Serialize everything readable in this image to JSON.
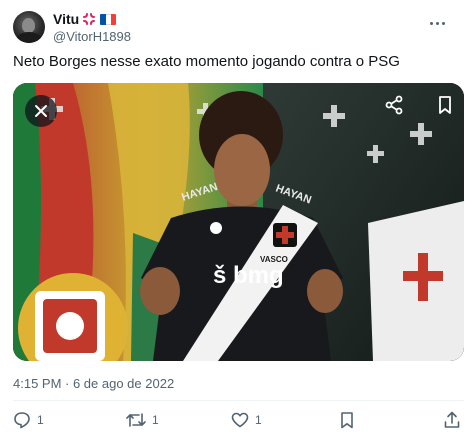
{
  "user": {
    "display_name": "Vitu",
    "handle": "@VitorH1898",
    "name_emoji": "anger-symbol-icon",
    "flag": "france-flag-icon",
    "flag_colors": [
      "#0055a4",
      "#ffffff",
      "#ef4135"
    ]
  },
  "tweet": {
    "text": "Neto Borges nesse exato momento jogando contra o PSG",
    "timestamp": "4:15 PM · 6 de ago de 2022"
  },
  "media": {
    "image": "photo-player-vasco-shirt",
    "shirt_texts": {
      "sponsor": "bmg",
      "sponsor_prefix": "š",
      "club": "VASCO",
      "shoulder_left": "HAYAN",
      "shoulder_right": "HAYAN"
    },
    "close_icon": "close-icon",
    "share_icon": "share-icon",
    "bookmark_icon": "bookmark-icon"
  },
  "actions": {
    "reply_count": "1",
    "retweet_count": "1",
    "like_count": "1",
    "icons": [
      "reply-icon",
      "retweet-icon",
      "like-icon",
      "bookmark-icon",
      "share-icon"
    ]
  },
  "colors": {
    "text": "#0f1419",
    "muted": "#536471",
    "divider": "#eff3f4",
    "overlay_button": "#0f1419"
  }
}
